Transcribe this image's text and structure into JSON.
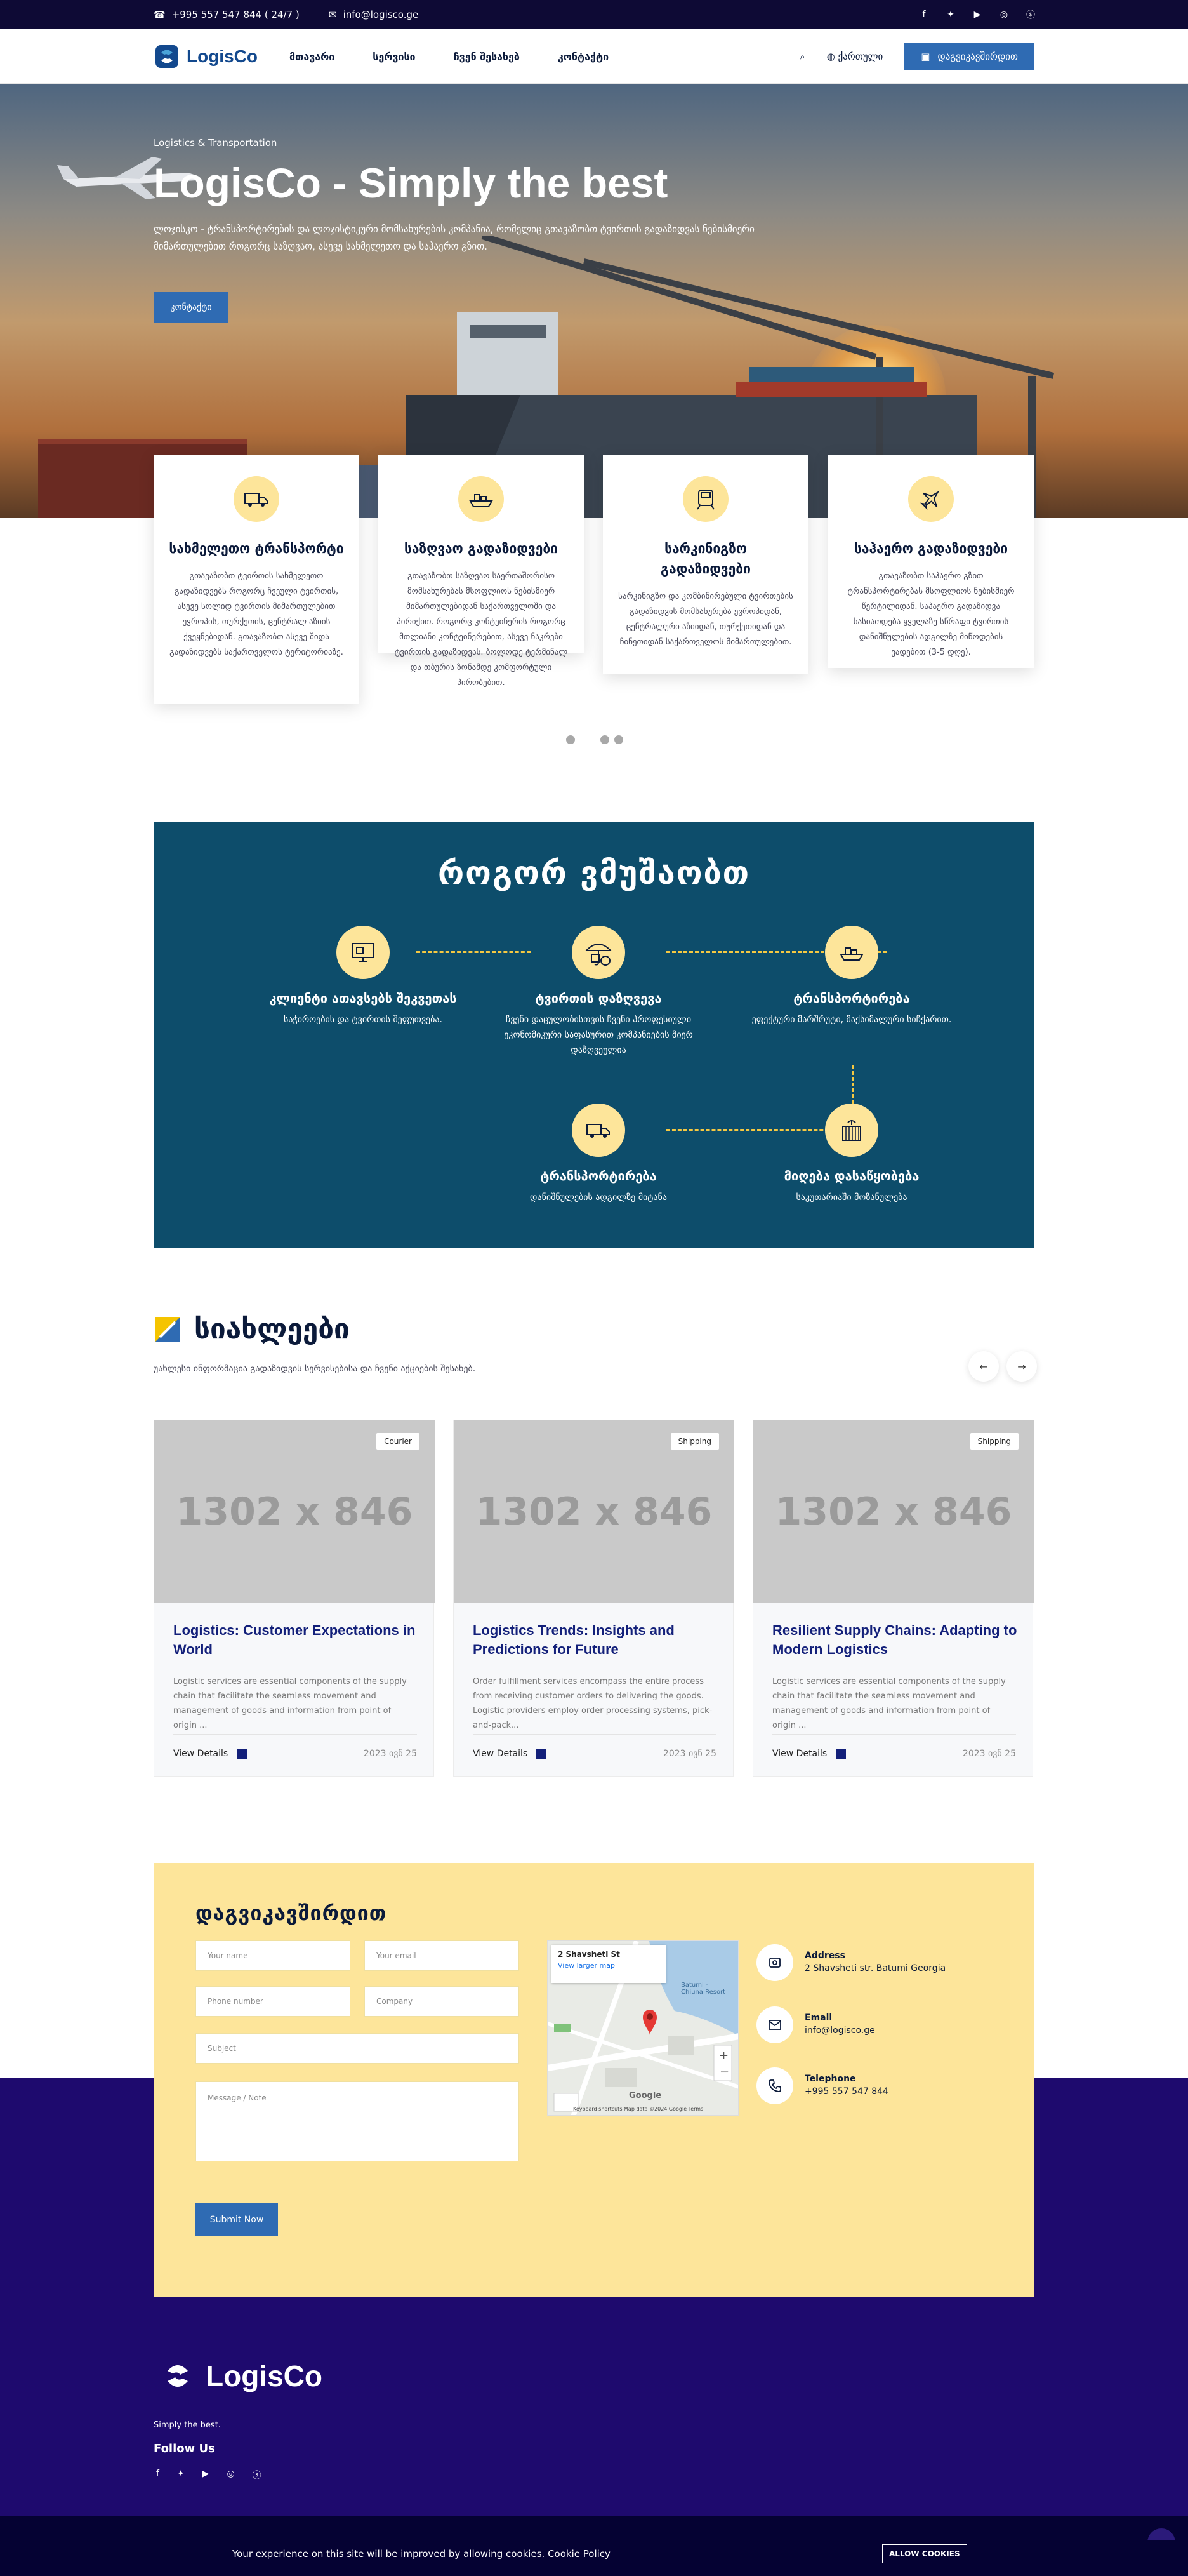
{
  "topbar": {
    "phone": "+995 557 547 844 ( 24/7 )",
    "email": "info@logisco.ge",
    "social": [
      "facebook-icon",
      "twitter-icon",
      "youtube-icon",
      "instagram-icon",
      "skype-icon"
    ]
  },
  "header": {
    "logo": "LogisCo",
    "nav": [
      "მთავარი",
      "სერვისი",
      "ჩვენ შესახებ",
      "კონტაქტი"
    ],
    "language": "ქართული",
    "track_button": "დაგვიკავშირდით"
  },
  "hero": {
    "eyebrow": "Logistics & Transportation",
    "title": "LogisCo - Simply the best",
    "subtitle": "ლოჯისკო - ტრანსპორტირების და ლოჯისტიკური მომსახურების კომპანია, რომელიც გთავაზობთ ტვირთის გადაზიდვას ნებისმიერი მიმართულებით როგორც საზღვაო, ასევე სახმელეთო და საჰაერო გზით.",
    "button": "კონტაქტი"
  },
  "services": [
    {
      "title": "სახმელეთო ტრანსპორტი",
      "text": "გთავაზობთ ტვირთის სახმელეთო გადაზიდვებს როგორც ჩვეული ტვირთის, ასევე სოლიდ ტვირთის მიმართულებით ევროპის, თურქეთის, ცენტრალ აზიის ქვეყნებიდან. გთავაზობთ ასევე შიდა გადაზიდვებს საქართველოს ტერიტორიაზე."
    },
    {
      "title": "საზღვაო გადაზიდვები",
      "text": "გთავაზობთ საზღვაო საერთაშორისო მომსახურებას მსოფლიოს ნებისმიერ მიმართულებიდან საქართველოში და პირიქით. როგორც კონტეინერის როგორც მთლიანი კონტეინერებით, ასევე ნაკრები ტვირთის გადაზიდვას. ბოლოდე ტერმინალ და თბურის ზონამდე კომფორტული პირობებით."
    },
    {
      "title": "სარკინიგზო გადაზიდვები",
      "text": "სარკინიგზო და კომბინირებული ტვირთების გადაზიდვის მომსახურება ევროპიდან, ცენტრალური აზიიდან, თურქეთიდან და ჩინეთიდან საქართველოს მიმართულებით."
    },
    {
      "title": "საჰაერო გადაზიდვები",
      "text": "გთავაზობთ საჰაერო გზით ტრანსპორტირებას მსოფლიოს ნებისმიერ წერტილიდან. საჰაერო გადაზიდვა ხასიათდება ყველაზე სწრაფი ტვირთის დანიშნულების ადგილზე მიწოდების ვადებით (3-5 დღე)."
    }
  ],
  "how": {
    "title": "როგორ ვმუშაობთ",
    "steps": [
      {
        "title": "კლიენტი ათავსებს შეკვეთას",
        "text": "საჭიროების და ტვირთის შეფუთვება."
      },
      {
        "title": "ტვირთის დაზღვევა",
        "text": "ჩვენი დაცულობისთვის ჩვენი პროფესიული ეკონომიკური საფასურით კომპანიების მიერ დაზღვეულია"
      },
      {
        "title": "ტრანსპორტირება",
        "text": "ეფექტური მარშრუტი, მაქსიმალური სიჩქარით."
      },
      {
        "title": "ტრანსპორტირება",
        "text": "დანიშნულების ადგილზე მიტანა"
      },
      {
        "title": "მიღება დასაწყობება",
        "text": "საკუთარიაში მოზანულება"
      }
    ]
  },
  "news": {
    "title": "სიახლეები",
    "subtitle": "უახლესი ინფორმაცია გადაზიდვის სერვისებისა და ჩვენი აქციების შესახებ.",
    "items": [
      {
        "tag": "Courier",
        "image": "1302 x 846",
        "title": "Logistics: Customer Expectations in World",
        "text": "Logistic services are essential components of the supply chain that facilitate the seamless movement and management of goods and information from point of origin ...",
        "link": "View Details",
        "date": "2023 ივნ 25"
      },
      {
        "tag": "Shipping",
        "image": "1302 x 846",
        "title": "Logistics Trends: Insights and Predictions for Future",
        "text": "Order fulfillment services encompass the entire process from receiving customer orders to delivering the goods. Logistic providers employ order processing systems, pick-and-pack...",
        "link": "View Details",
        "date": "2023 ივნ 25"
      },
      {
        "tag": "Shipping",
        "image": "1302 x 846",
        "title": "Resilient Supply Chains: Adapting to Modern Logistics",
        "text": "Logistic services are essential components of the supply chain that facilitate the seamless movement and management of goods and information from point of origin ...",
        "link": "View Details",
        "date": "2023 ივნ 25"
      }
    ]
  },
  "contact": {
    "title": "დაგვიკავშირდით",
    "placeholders": {
      "name": "Your name",
      "email": "Your email",
      "phone": "Phone number",
      "company": "Company",
      "subject": "Subject",
      "message": "Message / Note"
    },
    "submit": "Submit Now",
    "map": {
      "place": "2 Shavsheti St",
      "link": "View larger map",
      "label": "Batumi - Chiuna Resort",
      "google": "Google",
      "footer": "Keyboard shortcuts   Map data ©2024 Google   Terms"
    },
    "info": [
      {
        "label": "Address",
        "value": "2 Shavsheti str. Batumi Georgia",
        "icon": "map-icon"
      },
      {
        "label": "Email",
        "value": "info@logisco.ge",
        "icon": "mail-icon"
      },
      {
        "label": "Telephone",
        "value": "+995 557 547 844",
        "icon": "phone-icon"
      }
    ]
  },
  "footer": {
    "logo": "LogisCo",
    "tagline": "Simply the best.",
    "follow": "Follow Us"
  },
  "cookie": {
    "text": "Your experience on this site will be improved by allowing cookies.",
    "link": "Cookie Policy",
    "button": "ALLOW COOKIES"
  },
  "colors": {
    "accent": "#2f6bb3",
    "navy": "#0e0a35",
    "teal": "#0d4d6b",
    "yellow": "#fde59a",
    "purple": "#1e0a6e"
  }
}
